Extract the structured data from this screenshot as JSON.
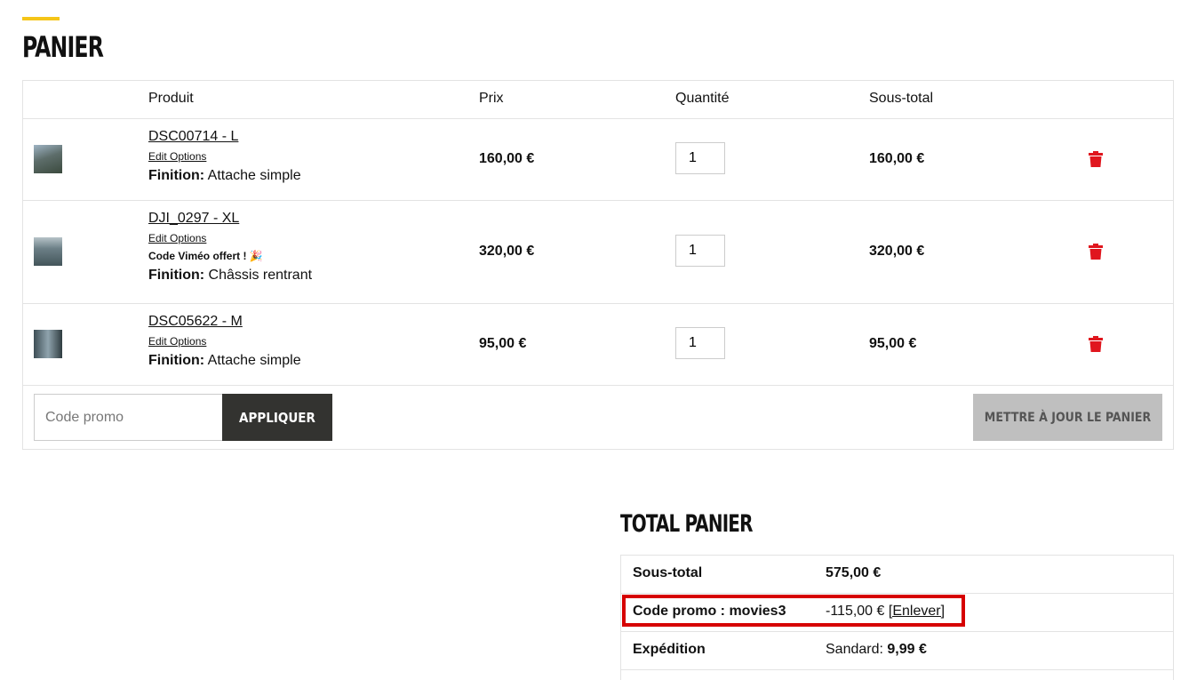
{
  "page": {
    "title": "PANIER"
  },
  "cart": {
    "headers": {
      "product": "Produit",
      "price": "Prix",
      "quantity": "Quantité",
      "subtotal": "Sous-total"
    },
    "items": [
      {
        "name": "DSC00714 - L",
        "edit": "Edit Options",
        "offer": "",
        "finish_label": "Finition:",
        "finish_value": "Attache simple",
        "price": "160,00 €",
        "qty": "1",
        "subtotal": "160,00 €"
      },
      {
        "name": "DJI_0297 - XL",
        "edit": "Edit Options",
        "offer": "Code Viméo offert ! 🎉",
        "finish_label": "Finition:",
        "finish_value": "Châssis rentrant",
        "price": "320,00 €",
        "qty": "1",
        "subtotal": "320,00 €"
      },
      {
        "name": "DSC05622 - M",
        "edit": "Edit Options",
        "offer": "",
        "finish_label": "Finition:",
        "finish_value": "Attache simple",
        "price": "95,00 €",
        "qty": "1",
        "subtotal": "95,00 €"
      }
    ],
    "promo_placeholder": "Code promo",
    "apply_label": "APPLIQUER",
    "update_label": "METTRE À JOUR LE PANIER"
  },
  "totals": {
    "title": "TOTAL PANIER",
    "subtotal_label": "Sous-total",
    "subtotal_value": "575,00 €",
    "promo_label": "Code promo : movies3",
    "promo_value": "-115,00 €",
    "promo_remove": "[Enlever]",
    "shipping_label": "Expédition",
    "shipping_method": "Sandard:",
    "shipping_value": "9,99 €"
  },
  "colors": {
    "accent": "#f5c518",
    "delete": "#e0161e",
    "highlight": "#d60000",
    "apply_bg": "#333330",
    "update_bg": "#bfbfbf"
  },
  "icons": {
    "delete": "trash-icon"
  }
}
